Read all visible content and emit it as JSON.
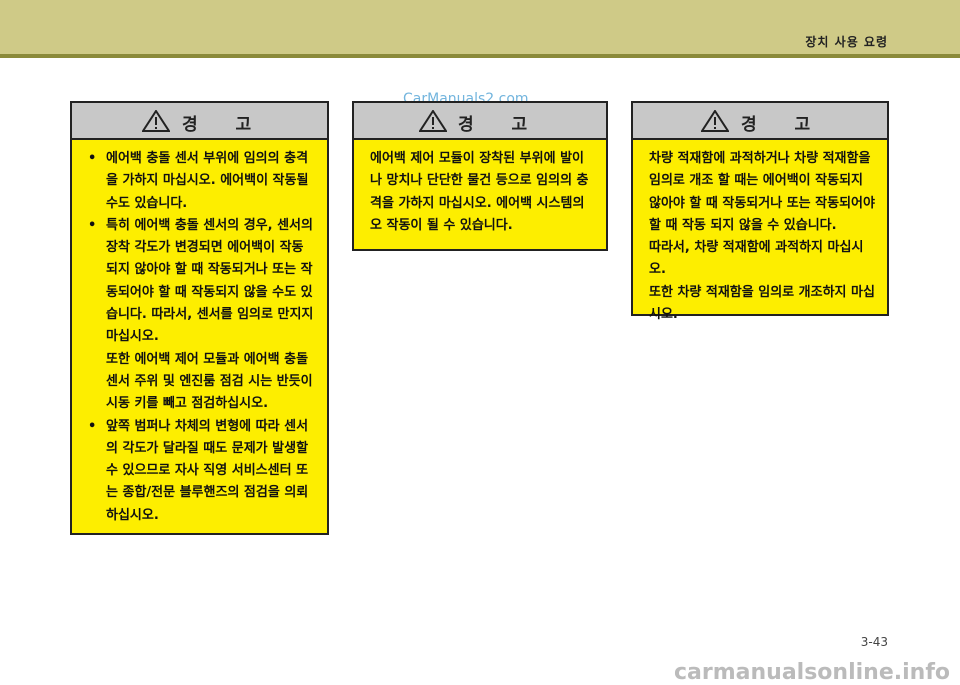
{
  "header": {
    "section_title": "장치 사용 요령"
  },
  "watermark": "CarManuals2.com",
  "warning_title": "경 고",
  "box1": {
    "items": [
      "에어백 충돌 센서 부위에 임의의 충격을 가하지 마십시오. 에어백이 작동될 수도 있습니다.",
      "특히 에어백 충돌 센서의 경우, 센서의 장착 각도가 변경되면 에어백이 작동되지 않아야 할 때 작동되거나 또는 작동되어야 할 때 작동되지 않을 수도 있습니다. 따라서, 센서를 임의로 만지지 마십시오.",
      "앞쪽 범퍼나 차체의 변형에 따라 센서의 각도가 달라질 때도 문제가 발생할 수 있으므로 자사 직영 서비스센터 또는 종합/전문 블루핸즈의 점검을 의뢰하십시오."
    ],
    "extra": "또한 에어백 제어 모듈과 에어백 충돌 센서 주위 및 엔진룸 점검 시는 반듯이 시동 키를 빼고 점검하십시오."
  },
  "box2": {
    "text": "에어백 제어 모듈이 장착된 부위에 발이나 망치나 단단한 물건 등으로 임의의 충격을 가하지 마십시오. 에어백 시스템의 오 작동이 될 수 있습니다."
  },
  "box3": {
    "p1": "차량 적재함에 과적하거나 차량 적재함을 임의로 개조 할 때는 에어백이 작동되지 않아야 할 때 작동되거나 또는 작동되어야 할 때 작동 되지 않을 수 있습니다.",
    "p2": "따라서, 차량 적재함에 과적하지 마십시오.",
    "p3": "또한 차량 적재함을 임의로 개조하지 마십시오."
  },
  "page_number": "3-43",
  "footer_url": "carmanualsonline.info"
}
